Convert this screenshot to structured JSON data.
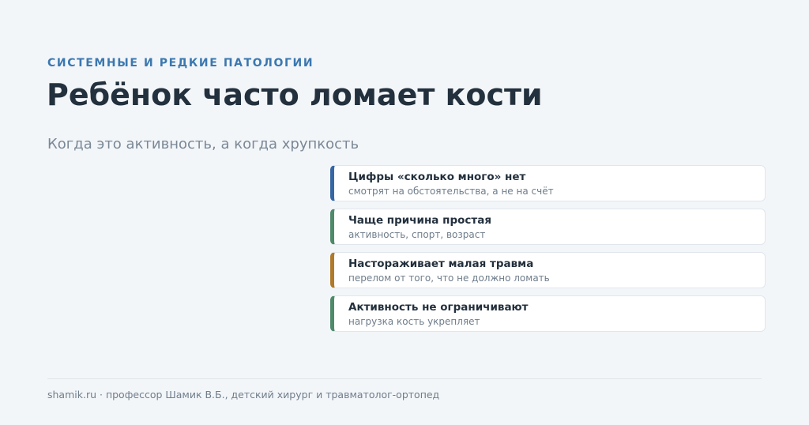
{
  "header": {
    "category": "СИСТЕМНЫЕ И РЕДКИЕ ПАТОЛОГИИ",
    "title": "Ребёнок часто ломает кости",
    "subtitle": "Когда это активность, а когда хрупкость"
  },
  "cards": [
    {
      "title": "Цифры «сколько много» нет",
      "desc": "смотрят на обстоятельства, а не на счёт",
      "accent": "#3667a4"
    },
    {
      "title": "Чаще причина простая",
      "desc": "активность, спорт, возраст",
      "accent": "#4f8a6b"
    },
    {
      "title": "Настораживает малая травма",
      "desc": "перелом от того, что не должно ломать",
      "accent": "#b07a2a"
    },
    {
      "title": "Активность не ограничивают",
      "desc": "нагрузка кость укрепляет",
      "accent": "#4f8a6b"
    }
  ],
  "footer": {
    "text": "shamik.ru · профессор Шамик В.Б., детский хирург и травматолог-ортопед"
  }
}
